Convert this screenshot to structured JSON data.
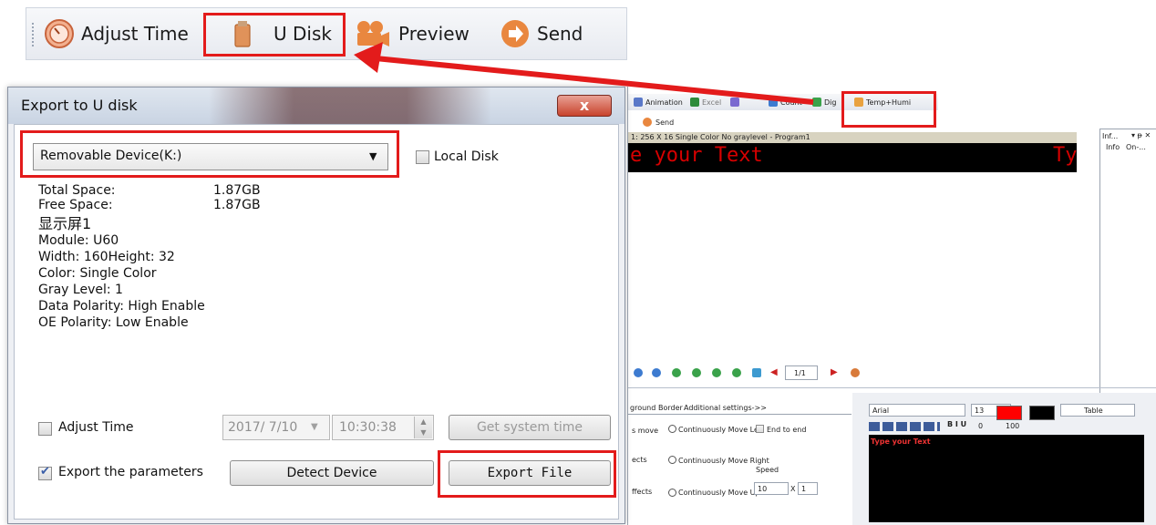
{
  "toolbar": {
    "items": [
      {
        "label": "Adjust Time",
        "icon": "clock-icon"
      },
      {
        "label": "U Disk",
        "icon": "usb-disk-icon"
      },
      {
        "label": "Preview",
        "icon": "camera-icon"
      },
      {
        "label": "Send",
        "icon": "arrow-right-icon"
      }
    ]
  },
  "dialog": {
    "title": "Export to U disk",
    "close_label": "x",
    "device_value": "Removable Device(K:)",
    "local_disk_label": "Local Disk",
    "info": [
      {
        "label": "Total Space:",
        "value": "1.87GB"
      },
      {
        "label": "Free Space:",
        "value": "1.87GB"
      }
    ],
    "screen_name": "显示屏1",
    "details": [
      "Module: U60",
      "Width: 160Height: 32",
      "Color: Single Color",
      "Gray Level: 1",
      "Data Polarity: High Enable",
      "OE Polarity: Low Enable"
    ],
    "adjust_time_label": "Adjust Time",
    "date_value": "2017/ 7/10",
    "time_value": "10:30:38",
    "get_system_time_label": "Get system time",
    "export_params_label": "Export the parameters",
    "detect_device_label": "Detect Device",
    "export_file_label": "Export File"
  },
  "software": {
    "toolbar1": [
      "Animation",
      "Excel",
      "Count",
      "Dig",
      "Temp+Humi"
    ],
    "send_label": "Send",
    "status": "1: 256 X 16  Single Color No graylevel - Program1",
    "led_text_left": "e your Text",
    "led_text_right": "Ty",
    "panel_title": "Inf...",
    "panel_tabs": [
      "Info",
      "On-..."
    ],
    "page_indicator": "1/1",
    "tabs": [
      "ground",
      "Border",
      "Additional settings->>"
    ],
    "labels": {
      "row1": "s move",
      "row2": "ects",
      "row3": "ffects",
      "opt1": "Continuously Move Left",
      "end_to_end": "End to end",
      "opt2": "Continuously Move Right",
      "speed": "Speed",
      "opt3": "Continuously Move Up",
      "speed_value": "10",
      "times_sep": "X",
      "times_value": "1"
    },
    "font_name": "Arial",
    "font_size": "13",
    "table_label": "Table",
    "spacing_value": "0",
    "scale_value": "100",
    "editor_text": "Type your Text"
  },
  "colors": {
    "highlight": "#e31b1b",
    "led_text": "#d60000"
  }
}
